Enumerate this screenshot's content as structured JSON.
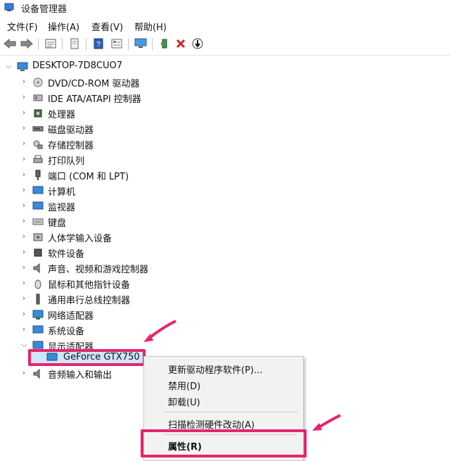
{
  "window": {
    "title": "设备管理器"
  },
  "menu": [
    "文件(F)",
    "操作(A)",
    "查看(V)",
    "帮助(H)"
  ],
  "toolbar": {
    "back": "back-arrow-icon",
    "forward": "forward-arrow-icon",
    "remove_color": "#d62020"
  },
  "tree": {
    "root": "DESKTOP-7D8CUO7",
    "categories": [
      "DVD/CD-ROM 驱动器",
      "IDE ATA/ATAPI 控制器",
      "处理器",
      "磁盘驱动器",
      "存储控制器",
      "打印队列",
      "端口 (COM 和 LPT)",
      "计算机",
      "监视器",
      "键盘",
      "人体学输入设备",
      "软件设备",
      "声音、视频和游戏控制器",
      "鼠标和其他指针设备",
      "通用串行总线控制器",
      "网络适配器",
      "系统设备",
      "显示适配器"
    ],
    "expanded_child": "GeForce GTX750",
    "last_category": "音频输入和输出"
  },
  "context_menu": {
    "items": [
      "更新驱动程序软件(P)...",
      "禁用(D)",
      "卸载(U)",
      "扫描检测硬件改动(A)",
      "属性(R)"
    ]
  },
  "colors": {
    "highlight": "#e8236e",
    "selection": "#cfe6f7"
  }
}
